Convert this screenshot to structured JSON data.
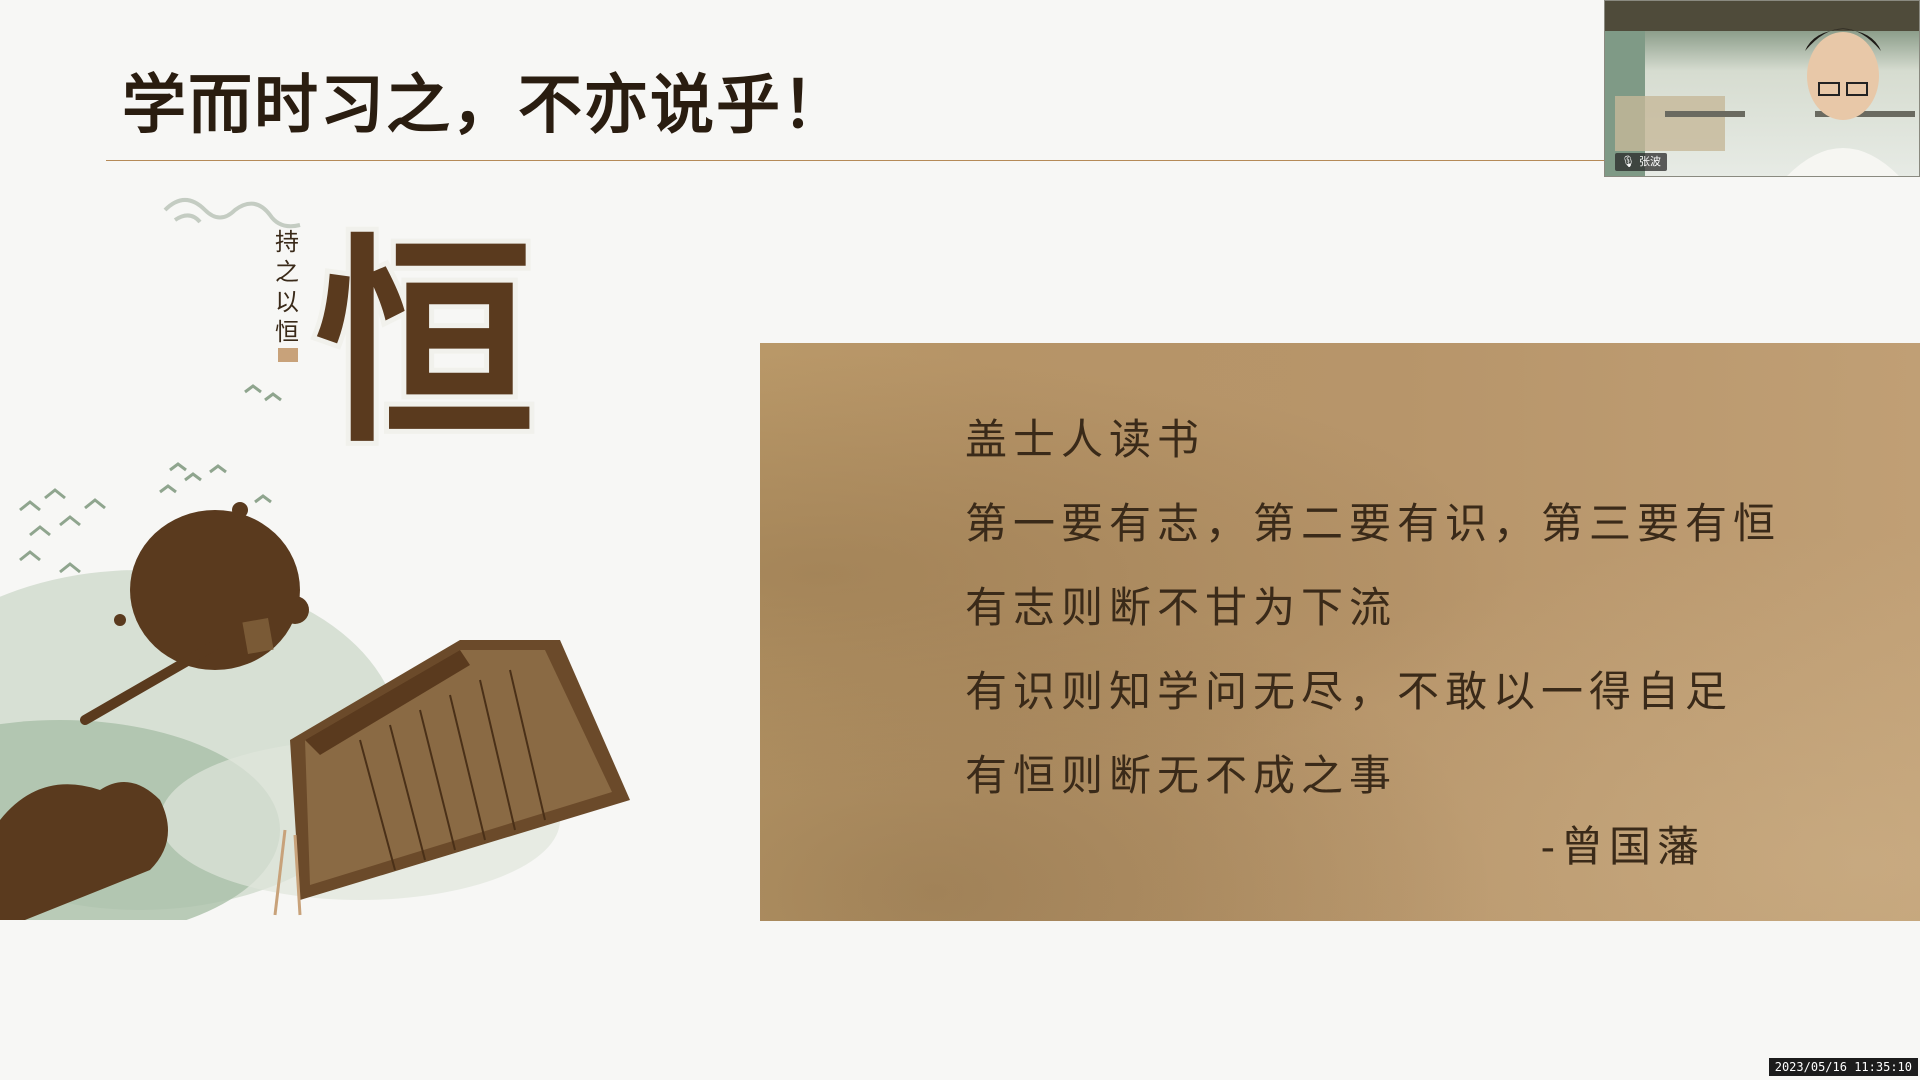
{
  "slide": {
    "title": "学而时习之，不亦说乎！",
    "illustration": {
      "big_character": "恒",
      "vertical_caption": "持之以恒"
    },
    "quote": {
      "lines": [
        "盖士人读书",
        "第一要有志，第二要有识，第三要有恒",
        "有志则断不甘为下流",
        "有识则知学问无尽，不敢以一得自足",
        "有恒则断无不成之事"
      ],
      "author": "-曾国藩"
    }
  },
  "webcam": {
    "participant_name": "张波"
  },
  "overlay": {
    "timestamp": "2023/05/16 11:35:10"
  },
  "colors": {
    "title_text": "#2a1d10",
    "rule": "#b58a57",
    "panel": "#b99868",
    "ink": "#5a3a1e",
    "mist_green": "#a9bfa7"
  },
  "icons": [
    "microphone-icon",
    "ink-brush-icon",
    "bird-icon"
  ]
}
